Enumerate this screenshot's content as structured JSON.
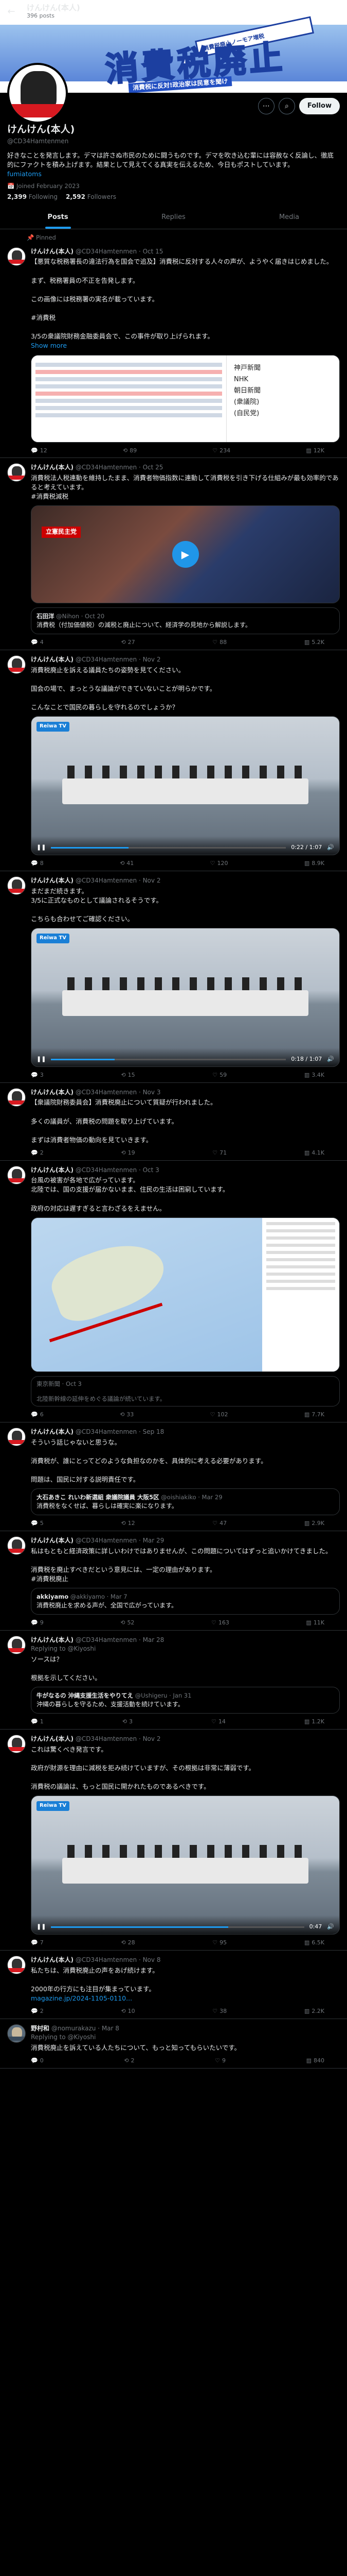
{
  "header": {
    "name": "けんけん(本人)",
    "posts": "396 posts"
  },
  "banner": {
    "big_text": "消費税廃止",
    "ribbon": "消費税廃止ノーモア増税",
    "caption": "消費税に反対!政治家は民意を聞け"
  },
  "profile": {
    "follow_label": "Follow",
    "name": "けんけん(本人)",
    "handle": "@CD34Hamtenmen",
    "bio": "好きなことを発言します。デマは許さぬ市民のために闘うものです。デマを吹き込む輩には容赦なく反論し、徹底的にファクトを積み上げます。結果として見えてくる真実を伝えるため、今日もポストしています。",
    "link": "fumiatoms",
    "joined": "Joined February 2023",
    "following": "2,399",
    "following_label": "Following",
    "followers": "2,592",
    "followers_label": "Followers"
  },
  "tabs": [
    {
      "label": "Posts"
    },
    {
      "label": "Replies"
    },
    {
      "label": "Media"
    }
  ],
  "pinned_label": "Pinned",
  "tweets": [
    {
      "name": "けんけん(本人)",
      "handle": "@CD34Hamtenmen · Oct 15",
      "text": "【悪質な税務署長の違法行為を国会で追及】消費税に反対する人々の声が、ようやく届きはじめました。\n\nまず、税務署員の不正を告発します。\n\nこの画像には税務署の実名が載っています。\n\n#消費税\n\n3/5の衆議院財務金融委員会で、この事件が取り上げられます。",
      "more": "Show more",
      "reply": "12",
      "rt": "89",
      "like": "234",
      "views": "12K"
    },
    {
      "name": "けんけん(本人)",
      "handle": "@CD34Hamtenmen · Oct 25",
      "text": "消費税法人税連動を維持したまま、消費者物価指数に連動して消費税を引き下げる仕組みが最も効率的であると考えています。\n#消費税減税",
      "reply": "4",
      "rt": "27",
      "like": "88",
      "views": "5.2K"
    },
    {
      "name": "けんけん(本人)",
      "handle": "@CD34Hamtenmen · Nov 2",
      "text": "消費税廃止を訴える議員たちの姿勢を見てください。\n\n国会の場で、まっとうな議論ができていないことが明らかです。\n\nこんなことで国民の暮らしを守れるのでしょうか？",
      "reply": "8",
      "rt": "41",
      "like": "120",
      "views": "8.9K"
    },
    {
      "name": "けんけん(本人)",
      "handle": "@CD34Hamtenmen · Nov 2",
      "text": "まだまだ続きます。\n3/5に正式なものとして議論されるそうです。\n\nこちらも合わせてご確認ください。",
      "reply": "3",
      "rt": "15",
      "like": "59",
      "views": "3.4K"
    },
    {
      "name": "けんけん(本人)",
      "handle": "@CD34Hamtenmen · Nov 3",
      "text": "【衆議院財務委員会】消費税廃止について質疑が行われました。\n\n多くの議員が、消費税の問題を取り上げています。\n\nまずは消費者物価の動向を見ていきます。",
      "reply": "2",
      "rt": "19",
      "like": "71",
      "views": "4.1K"
    },
    {
      "name": "けんけん(本人)",
      "handle": "@CD34Hamtenmen · Oct 3",
      "text": "台風の被害が各地で広がっています。\n北陸では、国の支援が届かないまま、住民の生活は困窮しています。\n\n政府の対応は遅すぎると言わざるをえません。",
      "reply": "6",
      "rt": "33",
      "like": "102",
      "views": "7.7K"
    },
    {
      "name": "けんけん(本人)",
      "handle": "@CD34Hamtenmen · Sep 18",
      "text": "そういう話じゃないと思うな。\n\n消費税が、誰にとってどのような負担なのかを、具体的に考える必要があります。\n\n問題は、国民に対する説明責任です。",
      "reply": "5",
      "rt": "12",
      "like": "47",
      "views": "2.9K"
    },
    {
      "name": "けんけん(本人)",
      "handle": "@CD34Hamtenmen · Mar 29",
      "text": "私はもともと経済政策に詳しいわけではありませんが、この問題についてはずっと追いかけてきました。\n\n消費税を廃止すべきだという意見には、一定の理由があります。\n#消費税廃止",
      "reply": "9",
      "rt": "52",
      "like": "163",
      "views": "11K"
    },
    {
      "name": "けんけん(本人)",
      "handle": "@CD34Hamtenmen · Mar 28",
      "replying": "Replying to @Kiyoshi",
      "text": "ソースは？\n\n根拠を示してください。",
      "reply": "1",
      "rt": "3",
      "like": "14",
      "views": "1.2K"
    },
    {
      "name": "けんけん(本人)",
      "handle": "@CD34Hamtenmen · Nov 2",
      "text": "これは驚くべき発言です。\n\n政府が財源を理由に減税を拒み続けていますが、その根拠は非常に薄弱です。\n\n消費税の議論は、もっと国民に開かれたものであるべきです。",
      "reply": "7",
      "rt": "28",
      "like": "95",
      "views": "6.5K"
    },
    {
      "name": "けんけん(本人)",
      "handle": "@CD34Hamtenmen · Nov 8",
      "text": "私たちは、消費税廃止の声をあげ続けます。\n\n2000年の行方にも注目が集まっています。",
      "link": "magazine.jp/2024-1105-0110...",
      "reply": "2",
      "rt": "10",
      "like": "38",
      "views": "2.2K"
    },
    {
      "name": "野村和",
      "handle": "@nomurakazu · Mar 8",
      "replying": "Replying to @Kiyoshi",
      "text": "消費税廃止を訴えている人たちについて、もっと知ってもらいたいです。",
      "reply": "0",
      "rt": "2",
      "like": "9",
      "views": "840"
    }
  ],
  "media": {
    "doc_right": [
      "神戸新聞",
      "NHK",
      "朝日新聞",
      "(衆議院)",
      "(自民党)"
    ],
    "video1_label": "立憲民主党",
    "quote1_name": "石田洋",
    "quote1_handle": "@Nihon · Oct 20",
    "quote1_text": "消費税（付加価値税）の減税と廃止について、経済学の見地から解説します。",
    "meet_channel": "Reiwa TV",
    "meet_time1": "0:22 / 1:07",
    "meet_time2": "0:18 / 1:07",
    "meet_time3": "0:47",
    "map_card": "東京新聞 · Oct 3",
    "map_card_text": "北陸新幹線の延伸をめぐる議論が続いています。",
    "quote2_name": "大石あきこ れいわ新選組 衆議院議員 大阪5区",
    "quote2_handle": "@oishiakiko · Mar 29",
    "quote2_text": "消費税をなくせば、暮らしは確実に楽になります。",
    "quote3_name": "akkiyamo",
    "quote3_handle": "@akkiyamo · Mar 7",
    "quote3_text": "消費税廃止を求める声が、全国で広がっています。",
    "quote4_name": "牛がなるの 沖縄支援生活をやりてえ",
    "quote4_handle": "@Ushigeru · Jan 31",
    "quote4_text": "沖縄の暮らしを守るため、支援活動を続けています。"
  }
}
